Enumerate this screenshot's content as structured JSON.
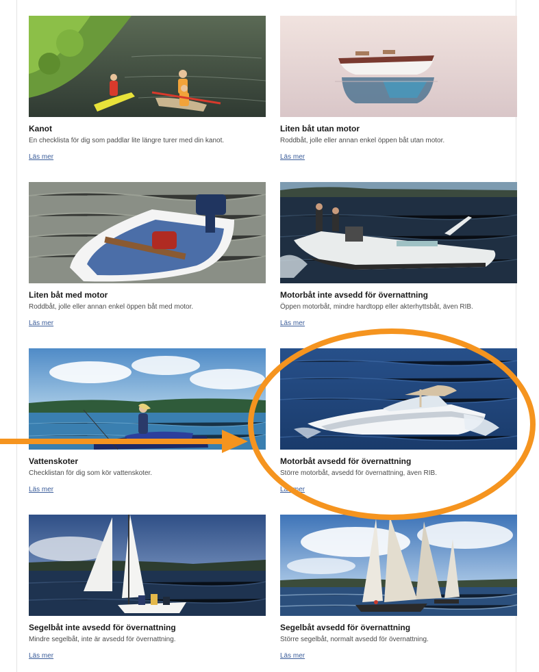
{
  "cards": [
    {
      "title": "Kanot",
      "description": "En checklista för dig som paddlar lite längre turer med din kanot.",
      "link": "Läs mer",
      "image": "kayak-photo"
    },
    {
      "title": "Liten båt utan motor",
      "description": "Roddbåt, jolle eller annan enkel öppen båt utan motor.",
      "link": "Läs mer",
      "image": "rowboat-photo"
    },
    {
      "title": "Liten båt med motor",
      "description": "Roddbåt, jolle eller annan enkel öppen båt med motor.",
      "link": "Läs mer",
      "image": "small-motorboat-photo"
    },
    {
      "title": "Motorbåt inte avsedd för övernattning",
      "description": "Öppen motorbåt, mindre hardtopp eller akterhyttsbåt, även RIB.",
      "link": "Läs mer",
      "image": "open-motorboat-photo"
    },
    {
      "title": "Vattenskoter",
      "description": "Checklistan för dig som kör vattenskoter.",
      "link": "Läs mer",
      "image": "jetski-photo"
    },
    {
      "title": "Motorbåt avsedd för övernattning",
      "description": "Större motorbåt, avsedd för övernattning, även RIB.",
      "link": "Läs mer",
      "image": "cabin-motorboat-photo"
    },
    {
      "title": "Segelbåt inte avsedd för övernattning",
      "description": "Mindre segelbåt, inte är avsedd för övernattning.",
      "link": "Läs mer",
      "image": "small-sailboat-photo"
    },
    {
      "title": "Segelbåt avsedd för övernattning",
      "description": "Större segelbåt, normalt avsedd för övernattning.",
      "link": "Läs mer",
      "image": "sailboats-photo"
    }
  ],
  "annotation": {
    "color": "#f5941f",
    "highlighted_card": "Motorbåt avsedd för övernattning"
  },
  "colors": {
    "link": "#3b5d9a",
    "water": "#2f5f8f"
  }
}
